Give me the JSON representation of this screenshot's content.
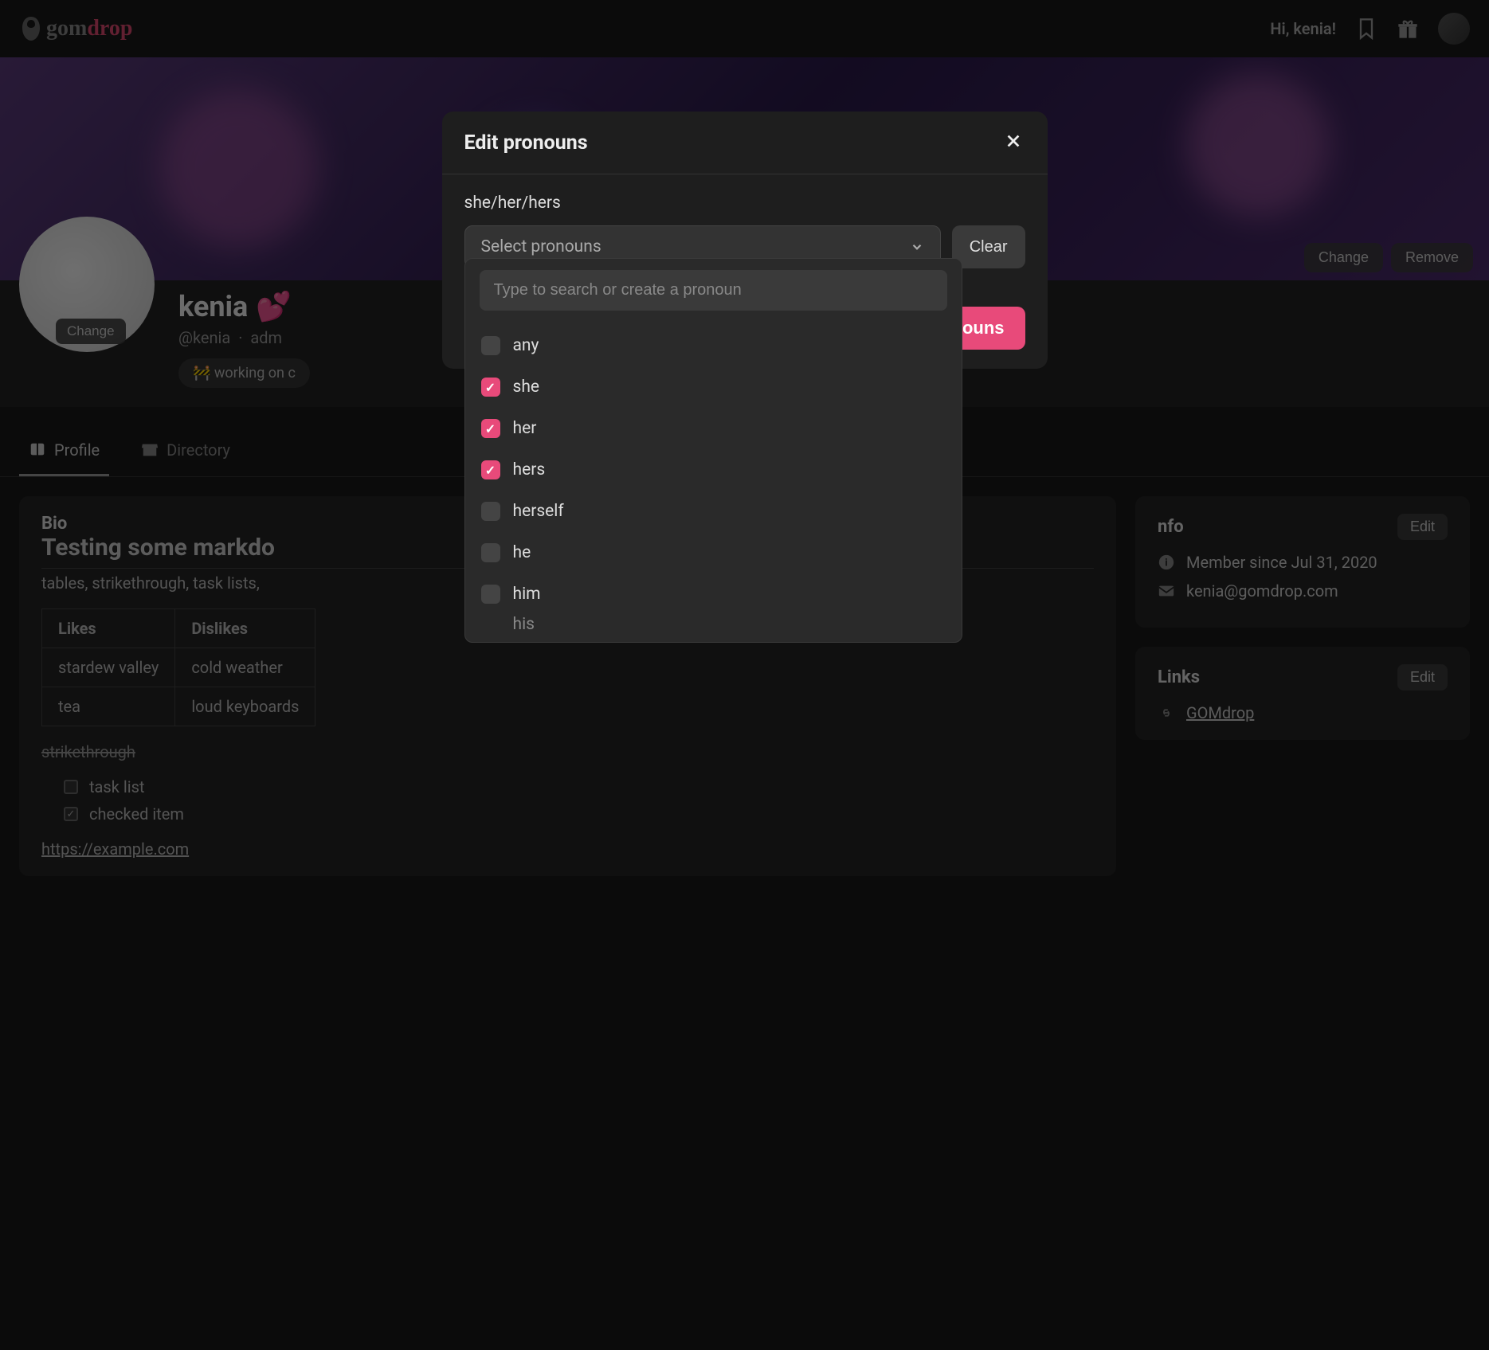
{
  "nav": {
    "logo_gom": "gom",
    "logo_drop": "drop",
    "greeting": "Hi, kenia!"
  },
  "banner": {
    "change_btn": "Change",
    "remove_btn": "Remove"
  },
  "profile": {
    "avatar_change": "Change",
    "name": "kenia",
    "hearts": "💕",
    "handle": "@kenia",
    "role": "adm",
    "status": "🚧 working on c"
  },
  "tabs": {
    "profile": "Profile",
    "directory": "Directory"
  },
  "bio": {
    "title": "Bio",
    "heading": "Testing some markdo",
    "sub": "tables, strikethrough, task lists,",
    "table": {
      "headers": [
        "Likes",
        "Dislikes"
      ],
      "rows": [
        [
          "stardew valley",
          "cold weather"
        ],
        [
          "tea",
          "loud keyboards"
        ]
      ]
    },
    "strike": "strikethrough",
    "tasks": [
      "task list",
      "checked item"
    ],
    "link": "https://example.com"
  },
  "info": {
    "title": "nfo",
    "edit": "Edit",
    "member_since": "Member since Jul 31, 2020",
    "email": "kenia@gomdrop.com"
  },
  "links": {
    "title": "Links",
    "edit": "Edit",
    "gomdrop": "GOMdrop"
  },
  "modal": {
    "title": "Edit pronouns",
    "current": "she/her/hers",
    "select_placeholder": "Select pronouns",
    "clear": "Clear",
    "set_btn": "ouns",
    "search_placeholder": "Type to search or create a pronoun",
    "options": [
      {
        "label": "any",
        "checked": false
      },
      {
        "label": "she",
        "checked": true
      },
      {
        "label": "her",
        "checked": true
      },
      {
        "label": "hers",
        "checked": true
      },
      {
        "label": "herself",
        "checked": false
      },
      {
        "label": "he",
        "checked": false
      },
      {
        "label": "him",
        "checked": false
      }
    ],
    "partial": "his"
  }
}
